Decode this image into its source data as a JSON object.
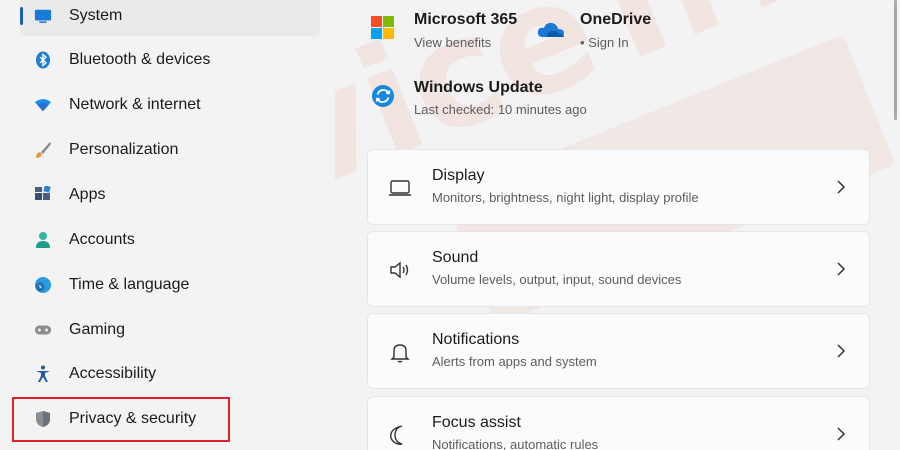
{
  "sidebar": {
    "items": [
      {
        "label": "System",
        "icon": "monitor-icon"
      },
      {
        "label": "Bluetooth & devices",
        "icon": "bluetooth-icon"
      },
      {
        "label": "Network & internet",
        "icon": "wifi-icon"
      },
      {
        "label": "Personalization",
        "icon": "brush-icon"
      },
      {
        "label": "Apps",
        "icon": "apps-icon"
      },
      {
        "label": "Accounts",
        "icon": "person-icon"
      },
      {
        "label": "Time & language",
        "icon": "globe-clock-icon"
      },
      {
        "label": "Gaming",
        "icon": "gamepad-icon"
      },
      {
        "label": "Accessibility",
        "icon": "accessibility-icon"
      },
      {
        "label": "Privacy & security",
        "icon": "shield-icon"
      }
    ]
  },
  "header": {
    "microsoft365": {
      "title": "Microsoft 365",
      "subtitle": "View benefits"
    },
    "onedrive": {
      "title": "OneDrive",
      "subtitle": "• Sign In"
    },
    "windows_update": {
      "title": "Windows Update",
      "subtitle": "Last checked: 10 minutes ago"
    }
  },
  "cards": [
    {
      "title": "Display",
      "subtitle": "Monitors, brightness, night light, display profile",
      "icon": "display-icon"
    },
    {
      "title": "Sound",
      "subtitle": "Volume levels, output, input, sound devices",
      "icon": "speaker-icon"
    },
    {
      "title": "Notifications",
      "subtitle": "Alerts from apps and system",
      "icon": "bell-icon"
    },
    {
      "title": "Focus assist",
      "subtitle": "Notifications, automatic rules",
      "icon": "moon-icon"
    }
  ],
  "watermark": "DeviceTricks",
  "colors": {
    "accent": "#1a5fb4",
    "highlight": "#e0212b",
    "watermark": "#e15f46"
  }
}
